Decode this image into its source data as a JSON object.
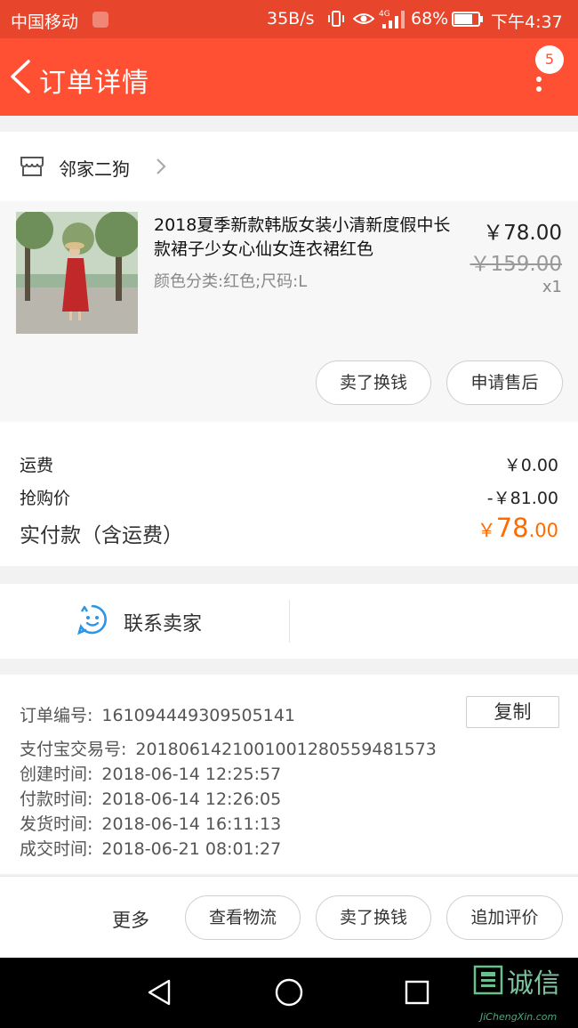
{
  "status_bar": {
    "carrier": "中国移动",
    "speed": "35B/s",
    "battery": "68%",
    "time": "下午4:37"
  },
  "nav": {
    "title": "订单详情",
    "badge": "5",
    "icons": {
      "back": "chevron-left-icon",
      "more": "more-vertical-icon"
    }
  },
  "shop": {
    "name": "邻家二狗",
    "icon": "store-icon"
  },
  "product": {
    "title": "2018夏季新款韩版女装小清新度假中长款裙子少女心仙女连衣裙红色",
    "attributes": "颜色分类:红色;尺码:L",
    "price": "￥78.00",
    "original_price": "￥159.00",
    "quantity": "x1",
    "buttons": {
      "resell": "卖了换钱",
      "after_sale": "申请售后"
    }
  },
  "fees": {
    "shipping_label": "运费",
    "shipping_value": "￥0.00",
    "discount_label": "抢购价",
    "discount_value": "-￥81.00",
    "total_label": "实付款（含运费）",
    "total_currency": "￥",
    "total_int": "78",
    "total_dec": ".00",
    "accent_color": "#ff6b00"
  },
  "contact": {
    "label": "联系卖家",
    "icon": "smiley-chat-icon"
  },
  "order_info": {
    "order_no_label": "订单编号:",
    "order_no": "161094449309505141",
    "copy": "复制",
    "alipay_label": "支付宝交易号:",
    "alipay_no": "2018061421001001280559481573",
    "created_label": "创建时间:",
    "created": "2018-06-14 12:25:57",
    "paid_label": "付款时间:",
    "paid": "2018-06-14 12:26:05",
    "shipped_label": "发货时间:",
    "shipped": "2018-06-14 16:11:13",
    "done_label": "成交时间:",
    "done": "2018-06-21 08:01:27"
  },
  "actions": {
    "more": "更多",
    "logistics": "查看物流",
    "resell": "卖了换钱",
    "review": "追加评价"
  },
  "watermark": {
    "text": "诚信",
    "domain": "JiChengXin.com"
  },
  "colors": {
    "header": "#ff5033",
    "status_bar": "#e8462c",
    "price_accent": "#ff6b00"
  }
}
